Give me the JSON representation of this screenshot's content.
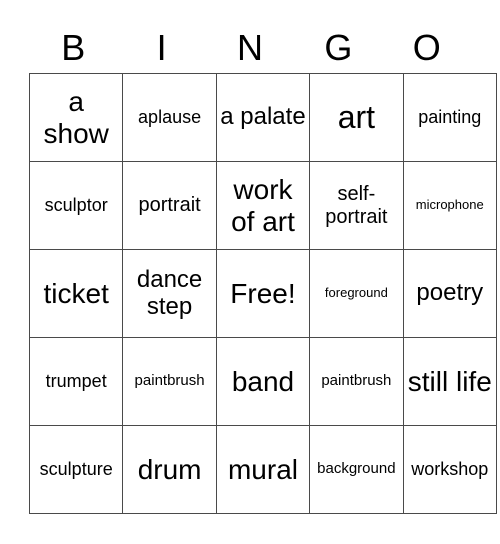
{
  "header": {
    "letters": [
      "B",
      "I",
      "N",
      "G",
      "O"
    ]
  },
  "card": {
    "rows": [
      [
        "a show",
        "aplause",
        "a palate",
        "art",
        "painting"
      ],
      [
        "sculptor",
        "portrait",
        "work of art",
        "self-portrait",
        "microphone"
      ],
      [
        "ticket",
        "dance step",
        "Free!",
        "foreground",
        "poetry"
      ],
      [
        "trumpet",
        "paintbrush",
        "band",
        "paintbrush",
        "still life"
      ],
      [
        "sculpture",
        "drum",
        "mural",
        "background",
        "workshop"
      ]
    ],
    "free_space_label": "Free!"
  }
}
